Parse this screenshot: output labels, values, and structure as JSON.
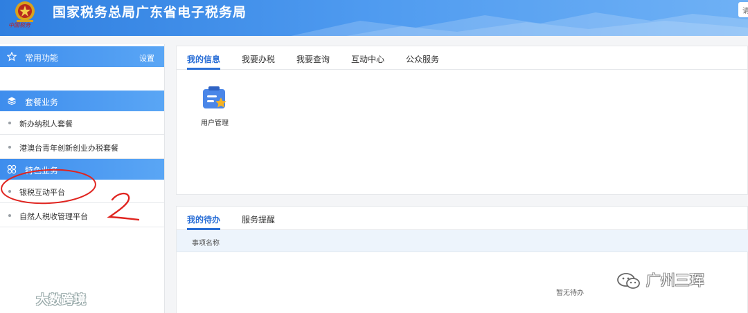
{
  "header": {
    "emblem_text": "中国税务",
    "title": "国家税务总局广东省电子税务局",
    "right_button": "请"
  },
  "sidebar": {
    "favorites": {
      "label": "常用功能",
      "settings": "设置"
    },
    "packages": {
      "label": "套餐业务",
      "items": [
        {
          "label": "新办纳税人套餐"
        },
        {
          "label": "港澳台青年创新创业办税套餐"
        }
      ]
    },
    "special": {
      "label": "特色业务",
      "items": [
        {
          "label": "银税互动平台"
        },
        {
          "label": "自然人税收管理平台"
        }
      ]
    }
  },
  "info_panel": {
    "tabs": [
      {
        "label": "我的信息",
        "active": true
      },
      {
        "label": "我要办税"
      },
      {
        "label": "我要查询"
      },
      {
        "label": "互动中心"
      },
      {
        "label": "公众服务"
      }
    ],
    "tiles": [
      {
        "label": "用户管理",
        "icon": "user-management-icon"
      }
    ]
  },
  "todo_panel": {
    "tabs": [
      {
        "label": "我的待办",
        "active": true
      },
      {
        "label": "服务提醒"
      }
    ],
    "column_header": "事项名称",
    "empty_text": "暂无待办"
  },
  "annotation": {
    "label": "2",
    "color": "#e0241f"
  },
  "watermarks": {
    "left": "大数跨境",
    "right": "广州三珲"
  },
  "colors": {
    "header_start": "#2f7fe0",
    "header_end": "#6fb1f5",
    "section_header": "#3e8ded",
    "active_tab": "#2b6fd6",
    "table_header_bg": "#edf4fc"
  }
}
